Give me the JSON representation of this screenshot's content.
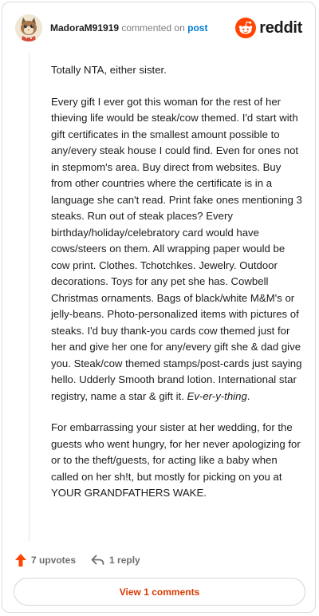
{
  "header": {
    "username": "MadoraM91919",
    "action_text": "commented on",
    "post_link": "post",
    "logo_text": "reddit",
    "avatar_icon": "avatar-cat-icon",
    "logo_icon": "reddit-alien-icon"
  },
  "comment": {
    "paragraphs": [
      "Totally NTA, either sister.",
      "Every gift I ever got this woman for the rest of her thieving life would be steak/cow themed. I'd start with gift certificates in the smallest amount possible to any/every steak house I could find. Even for ones not in stepmom's area. Buy direct from websites. Buy from other countries where the certificate is in a language she can't read. Print fake ones mentioning 3 steaks. Run out of steak places? Every birthday/holiday/celebratory card would have cows/steers on them. All wrapping paper would be cow print. Clothes. Tchotchkes. Jewelry. Outdoor decorations. Toys for any pet she has. Cowbell Christmas ornaments. Bags of black/white M&M's or jelly-beans. Photo-personalized items with pictures of steaks. I'd buy thank-you cards cow themed just for her and give her one for any/every gift she & dad give you. Steak/cow themed stamps/post-cards just saying hello. Udderly Smooth brand lotion. International star registry, name a star & gift it.",
      "For embarrassing your sister at her wedding, for the guests who went hungry, for her never apologizing for or to the theft/guests, for acting like a baby when called on her sh!t, but mostly for picking on you at YOUR GRANDFATHERS WAKE."
    ],
    "emphasis": "Ev-er-y-thing",
    "emphasis_suffix": "."
  },
  "actions": {
    "upvotes": "7 upvotes",
    "reply": "1 reply",
    "upvote_icon": "upvote-arrow-icon",
    "reply_icon": "reply-arrow-icon",
    "upvote_color": "#ff4500"
  },
  "view_comments": "View 1 comments",
  "colors": {
    "accent": "#d93a00",
    "link": "#0079d3",
    "reddit_orange": "#ff4500"
  }
}
